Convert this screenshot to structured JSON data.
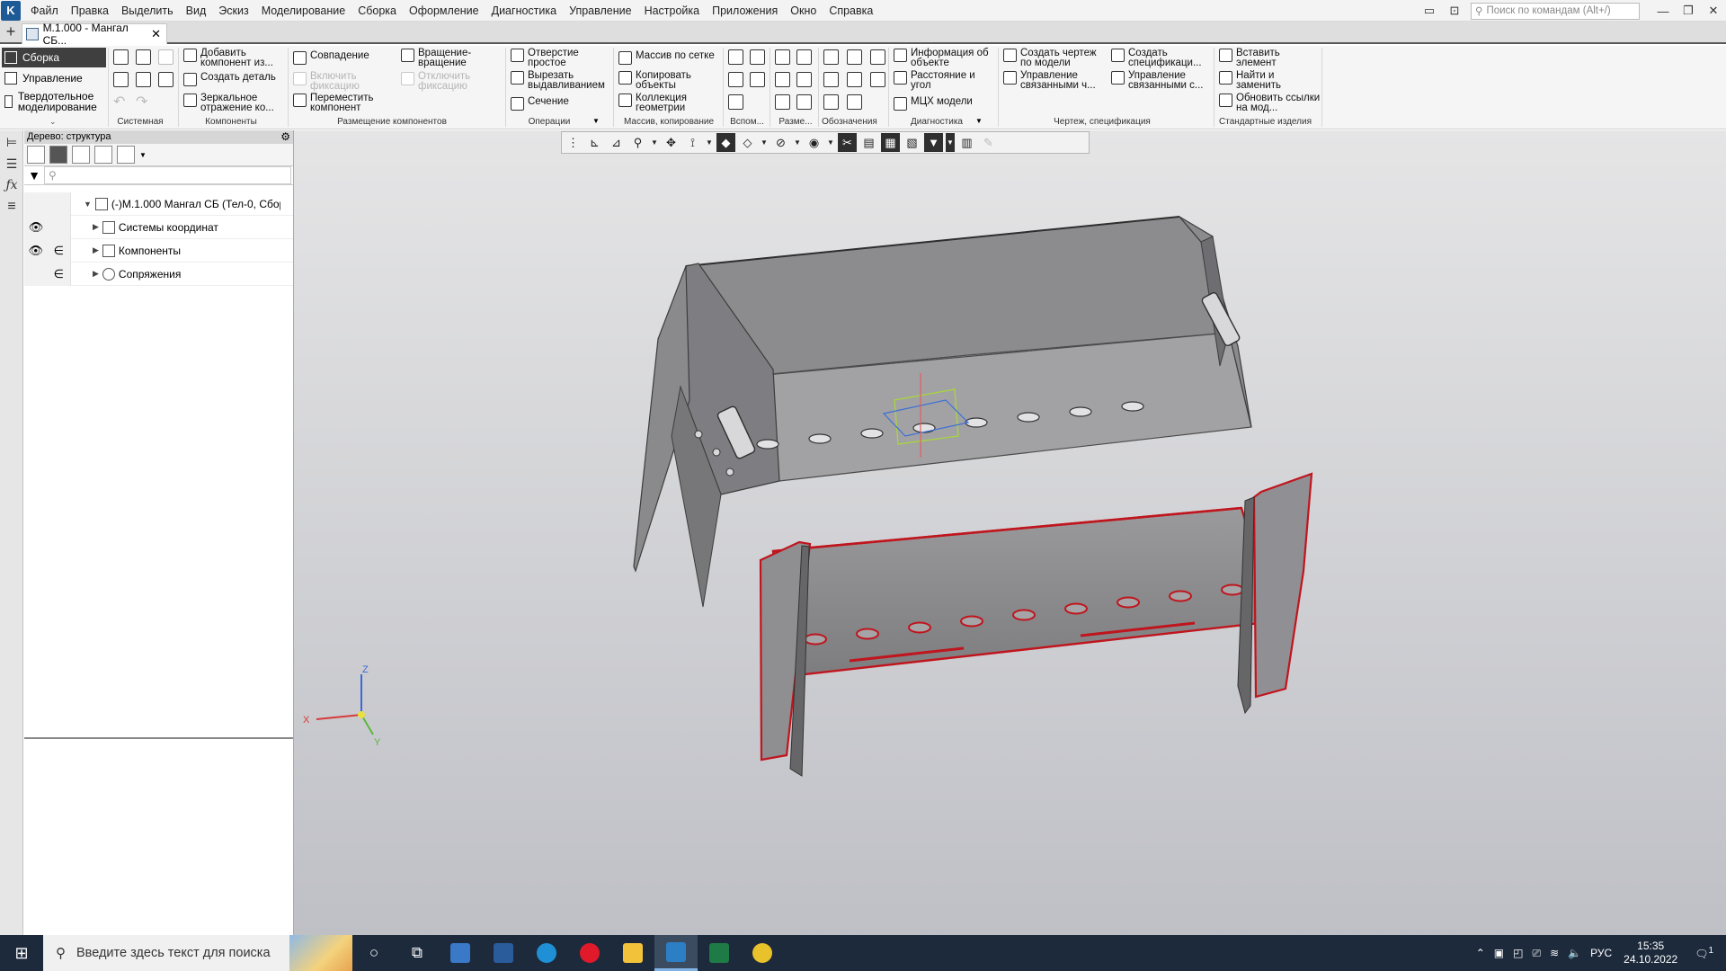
{
  "menubar": {
    "items": [
      "Файл",
      "Правка",
      "Выделить",
      "Вид",
      "Эскиз",
      "Моделирование",
      "Сборка",
      "Оформление",
      "Диагностика",
      "Управление",
      "Настройка",
      "Приложения",
      "Окно",
      "Справка"
    ],
    "search_placeholder": "Поиск по командам (Alt+/)"
  },
  "tabs": {
    "doc_title": "М.1.000 - Мангал СБ..."
  },
  "ribbon": {
    "modes": [
      "Сборка",
      "Управление",
      "Твердотельное моделирование"
    ],
    "groups": {
      "system": "Системная",
      "components": "Компоненты",
      "placement": "Размещение компонентов",
      "operations": "Операции",
      "array": "Массив, копирование",
      "aux": "Вспом...",
      "dims": "Разме...",
      "notation": "Обозначения",
      "diagnostics": "Диагностика",
      "drawing": "Чертеж, спецификация",
      "std": "Стандартные изделия"
    },
    "buttons": {
      "add_component": "Добавить компонент из...",
      "create_part": "Создать деталь",
      "mirror": "Зеркальное отражение ко...",
      "coincidence": "Совпадение",
      "enable_fix": "Включить фиксацию",
      "move_component": "Переместить компонент",
      "rotation": "Вращение-вращение",
      "disable_fix": "Отключить фиксацию",
      "simple_hole": "Отверстие простое",
      "extrude_cut": "Вырезать выдавливанием",
      "section": "Сечение",
      "grid_array": "Массив по сетке",
      "copy_objects": "Копировать объекты",
      "geometry_collection": "Коллекция геометрии",
      "object_info": "Информация об объекте",
      "distance_angle": "Расстояние и угол",
      "mass_props": "МЦХ модели",
      "create_drawing": "Создать чертеж по модели",
      "manage_linked": "Управление связанными ч...",
      "create_spec": "Создать спецификаци...",
      "manage_linked_spec": "Управление связанными с...",
      "insert_element": "Вставить элемент",
      "find_replace": "Найти и заменить",
      "update_links": "Обновить ссылки на мод..."
    }
  },
  "tree": {
    "header": "Дерево: структура",
    "search_placeholder": "",
    "root": "М.1.000 Мангал СБ (Тел-0, Сбор",
    "root_prefix": "(-)",
    "nodes": [
      "Системы координат",
      "Компоненты",
      "Сопряжения"
    ]
  },
  "viewport": {
    "axes": {
      "x": "X",
      "y": "Y",
      "z": "Z"
    }
  },
  "taskbar": {
    "search_placeholder": "Введите здесь текст для поиска",
    "lang": "РУС",
    "time": "15:35",
    "date": "24.10.2022",
    "notification_count": "1"
  },
  "colors": {
    "selection": "#c0151d",
    "accent": "#3f3f3f",
    "taskbar": "#1c2a3c"
  }
}
